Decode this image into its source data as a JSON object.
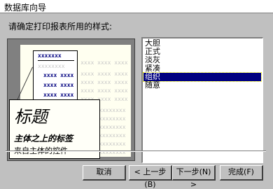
{
  "window": {
    "title": "数据库向导"
  },
  "prompt": "请确定打印报表所用的样式:",
  "preview": {
    "header_marks": "xxxxxxx",
    "light_row": "xxxxxxxx",
    "bold_row": "xxxx xxxx",
    "fill_row": "xxxx xxxx xxxx xxxx",
    "title_text": "标题",
    "subtitle_text": "主体之上的标签",
    "from_text": "来自主体的控件"
  },
  "styles": {
    "items": [
      "大胆",
      "正式",
      "淡灰",
      "紧凑",
      "组织",
      "随意"
    ],
    "selected": "组织"
  },
  "buttons": {
    "cancel": "取消",
    "back": "< 上一步(B)",
    "next": "下一步(N) >",
    "finish": "完成(F)"
  }
}
